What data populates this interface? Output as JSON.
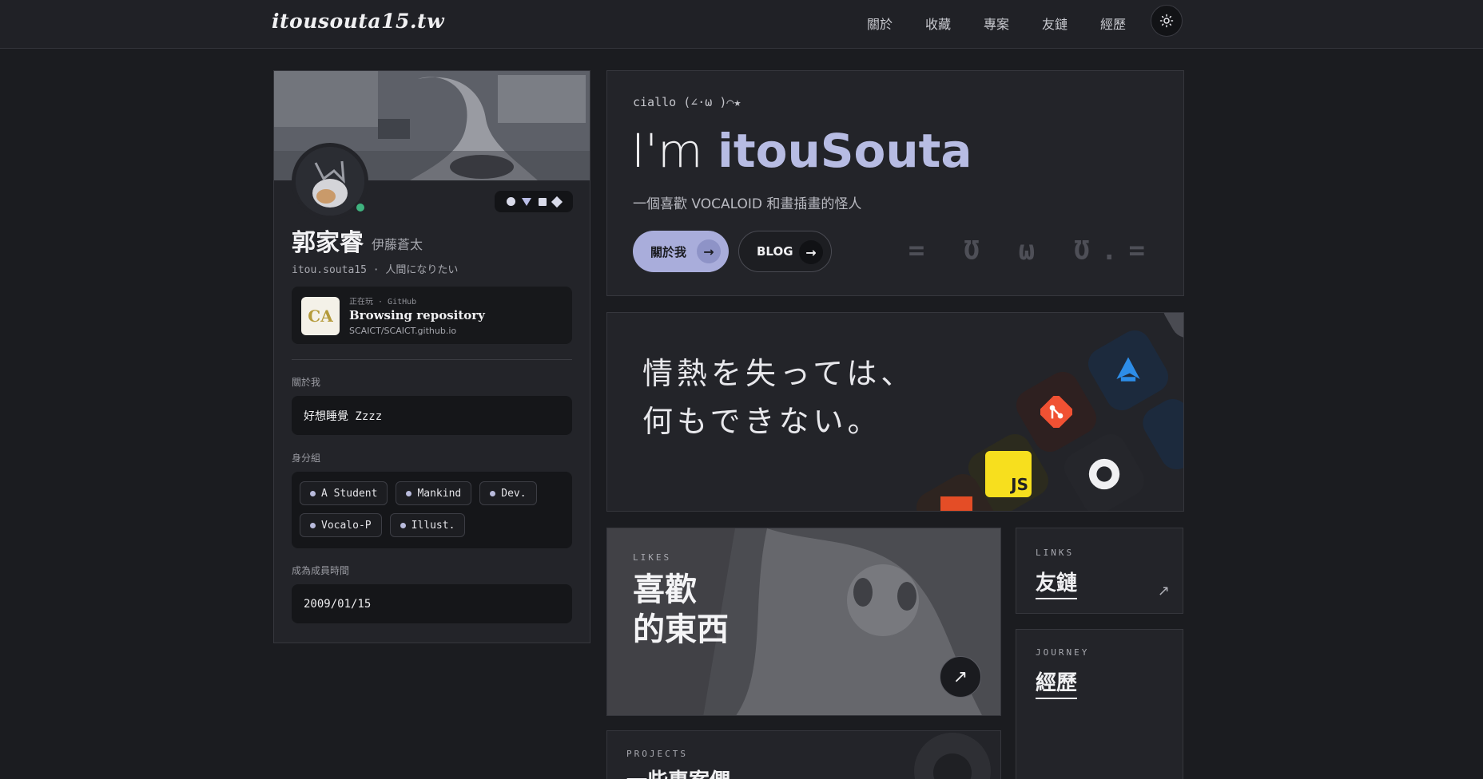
{
  "site": {
    "logo": "itousouta15.tw"
  },
  "nav": {
    "items": [
      {
        "label": "關於"
      },
      {
        "label": "收藏"
      },
      {
        "label": "專案"
      },
      {
        "label": "友鏈"
      },
      {
        "label": "經歷"
      }
    ],
    "theme_icon": "sun-icon"
  },
  "profile": {
    "name": "郭家睿",
    "alt_name": "伊藤蒼太",
    "handle": "itou.souta15 · 人間になりたい",
    "badge_icons": [
      "circle-icon",
      "triangle-icon",
      "square-icon",
      "diamond-icon"
    ],
    "activity": {
      "meta": "正在玩 · GitHub",
      "title": "Browsing repository",
      "subtitle": "SCAICT/SCAICT.github.io",
      "icon_text": "CA"
    },
    "about_label": "關於我",
    "about_value": "好想睡覺 Zzzz",
    "roles_label": "身分組",
    "roles": [
      "A Student",
      "Mankind",
      "Dev.",
      "Vocalo-P",
      "Illust."
    ],
    "member_since_label": "成為成員時間",
    "member_since": "2009/01/15"
  },
  "hero": {
    "greeting": "ciallo (∠·ω )⌒★",
    "title_prefix": "I'm ",
    "title_name": "itouSouta",
    "subtitle": "一個喜歡 VOCALOID 和畫插畫的怪人",
    "primary_button": "關於我",
    "secondary_button": "BLOG",
    "arrow": "→",
    "kaomoji": "= Ʊ ω Ʊ.="
  },
  "quote": {
    "line1": "情熱を失っては、",
    "line2": "何もできない。",
    "tiles": [
      "azure-devops-icon",
      "git-icon",
      "javascript-icon",
      "github-icon",
      "html-icon"
    ]
  },
  "likes": {
    "eyebrow": "LIKES",
    "title_line1": "喜歡",
    "title_line2": "的東西",
    "arrow": "↗"
  },
  "links_card": {
    "eyebrow": "LINKS",
    "title": "友鏈",
    "arrow": "↗"
  },
  "journey_card": {
    "eyebrow": "JOURNEY",
    "title": "經歷"
  },
  "projects_card": {
    "eyebrow": "PROJECTS",
    "title": "一些專案們"
  }
}
